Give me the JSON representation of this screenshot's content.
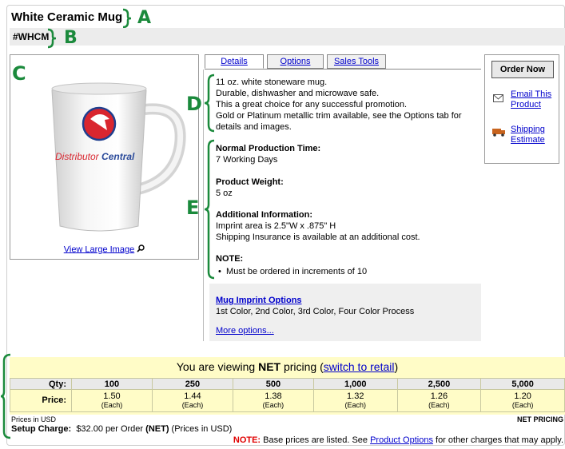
{
  "product": {
    "title": "White Ceramic Mug",
    "sku": "#WHCM",
    "view_large": "View Large Image"
  },
  "callouts": {
    "a": "A",
    "b": "B",
    "c": "C",
    "d": "D",
    "e": "E"
  },
  "tabs": [
    {
      "label": "Details"
    },
    {
      "label": "Options"
    },
    {
      "label": "Sales Tools"
    }
  ],
  "details": {
    "lines": [
      "11 oz. white stoneware mug.",
      "Durable, dishwasher and microwave safe.",
      "This a great choice for any successful promotion.",
      "Gold or Platinum metallic trim available, see the Options tab for",
      "details and images."
    ],
    "production_time_label": "Normal Production Time:",
    "production_time": "7 Working Days",
    "weight_label": "Product Weight:",
    "weight": "5 oz",
    "additional_label": "Additional Information:",
    "additional_1": "Imprint area is 2.5\"W x .875\" H",
    "additional_2": "Shipping Insurance is available at an additional cost.",
    "note_label": "NOTE:",
    "note_item": "Must be ordered in increments of 10"
  },
  "imprint": {
    "link": "Mug Imprint Options",
    "text": "1st Color, 2nd Color, 3rd Color, Four Color Process",
    "more": "More options..."
  },
  "sidebar": {
    "order_now": "Order Now",
    "email_1": "Email This",
    "email_2": "Product",
    "ship_1": "Shipping",
    "ship_2": "Estimate"
  },
  "pricing": {
    "viewing_prefix": "You are viewing ",
    "viewing_bold": "NET",
    "viewing_mid": " pricing (",
    "switch_link": "switch to retail",
    "viewing_end": ")",
    "qty_label": "Qty:",
    "price_label": "Price:",
    "quantities": [
      "100",
      "250",
      "500",
      "1,000",
      "2,500",
      "5,000"
    ],
    "prices": [
      "1.50",
      "1.44",
      "1.38",
      "1.32",
      "1.26",
      "1.20"
    ],
    "unit": "(Each)",
    "currency_note": "Prices in USD",
    "net_pricing": "NET PRICING",
    "setup_label": "Setup Charge:",
    "setup_value": "$32.00 per Order ",
    "setup_net": "(NET)",
    "setup_end": " (Prices in USD)",
    "note_label": "NOTE:",
    "note_text": " Base prices are listed. See ",
    "note_link": "Product Options",
    "note_end": " for other charges that may apply."
  },
  "logo_text": "DistributorCentral",
  "colors": {
    "callout_green": "#1b8a3c",
    "link_blue": "#0000cc",
    "price_yellow": "#fffcc7",
    "note_red": "#e00000"
  }
}
